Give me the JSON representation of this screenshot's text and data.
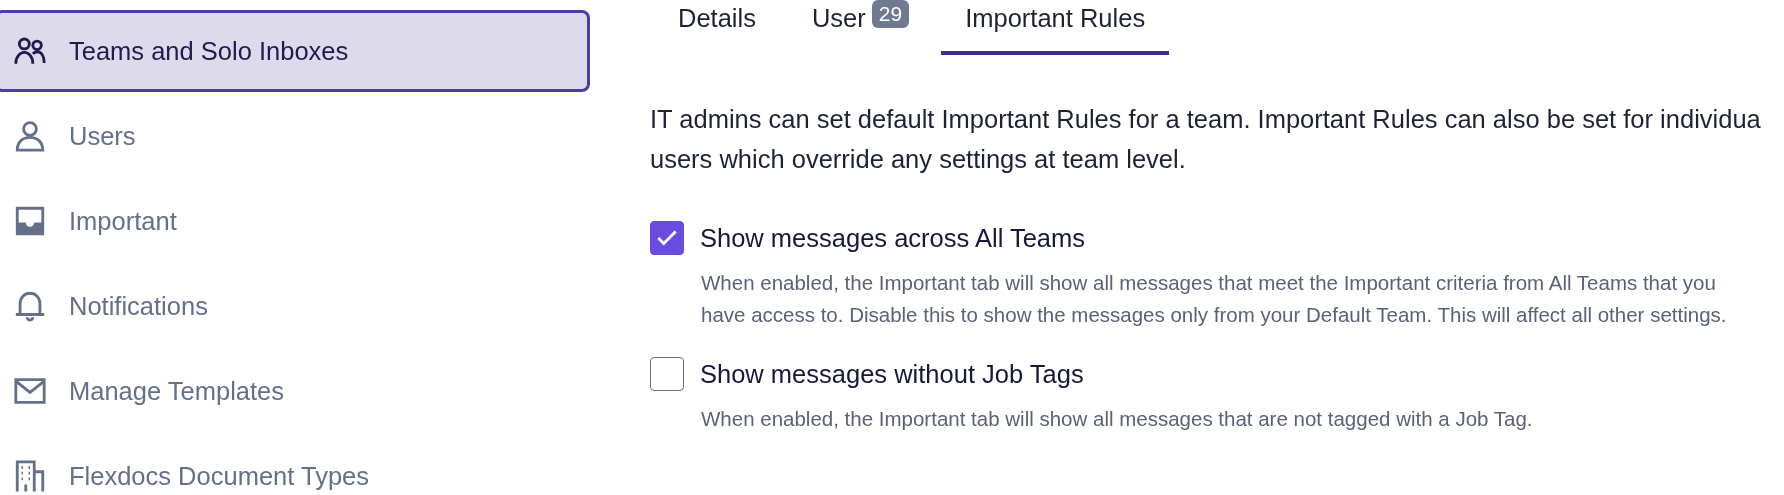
{
  "sidebar": {
    "items": [
      {
        "label": "Teams and Solo Inboxes",
        "kind": "people",
        "selected": true
      },
      {
        "label": "Users",
        "kind": "person",
        "selected": false
      },
      {
        "label": "Important",
        "kind": "inbox",
        "selected": false
      },
      {
        "label": "Notifications",
        "kind": "bell",
        "selected": false
      },
      {
        "label": "Manage Templates",
        "kind": "mail",
        "selected": false
      },
      {
        "label": "Flexdocs Document Types",
        "kind": "building",
        "selected": false
      }
    ]
  },
  "tabs": [
    {
      "label": "Details",
      "selected": false
    },
    {
      "label": "User",
      "badge": "29",
      "selected": false
    },
    {
      "label": "Important Rules",
      "selected": true
    }
  ],
  "intro": [
    "IT admins can set default Important Rules for a team. Important Rules can also be set for individua",
    "users which override any settings at team level."
  ],
  "options": [
    {
      "label": "Show messages across All Teams",
      "checked": true,
      "description": "When enabled, the Important tab will show all messages that meet the Important criteria from All Teams that you have access to. Disable this to show the messages only from your Default Team. This will affect all other settings."
    },
    {
      "label": "Show messages without Job Tags",
      "checked": false,
      "description": "When enabled, the Important tab will show all messages that are not tagged with a Job Tag."
    }
  ]
}
